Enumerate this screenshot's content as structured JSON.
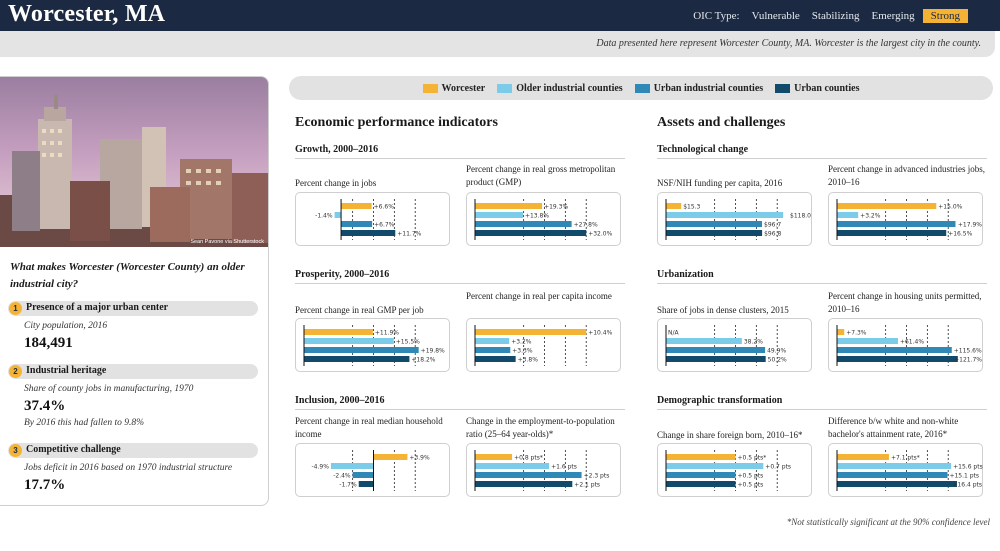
{
  "header": {
    "city": "Worcester, MA",
    "oic_label": "OIC Type:",
    "oic_types": [
      "Vulnerable",
      "Stabilizing",
      "Emerging",
      "Strong"
    ],
    "oic_selected": "Strong"
  },
  "subtitle": "Data presented here represent Worcester County, MA. Worcester is the largest city in the county.",
  "photo": {
    "credit": "Sean Pavone via Shutterstock"
  },
  "question": "What makes Worcester (Worcester County) an older industrial city?",
  "criteria": [
    {
      "number": "1",
      "title": "Presence of a major urban center",
      "label": "City population, 2016",
      "value": "184,491",
      "note": ""
    },
    {
      "number": "2",
      "title": "Industrial heritage",
      "label": "Share of county jobs in manufacturing, 1970",
      "value": "37.4%",
      "note": "By 2016 this had fallen to 9.8%"
    },
    {
      "number": "3",
      "title": "Competitive challenge",
      "label": "Jobs deficit in 2016 based on 1970 industrial structure",
      "value": "17.7%",
      "note": ""
    }
  ],
  "legend": [
    {
      "label": "Worcester",
      "color": "#f5b335"
    },
    {
      "label": "Older industrial counties",
      "color": "#7ccbe8"
    },
    {
      "label": "Urban industrial counties",
      "color": "#2f88b5"
    },
    {
      "label": "Urban counties",
      "color": "#124a6b"
    }
  ],
  "columns": {
    "left": "Economic performance indicators",
    "right": "Assets and challenges"
  },
  "sections": {
    "growth": "Growth, 2000–2016",
    "prosperity": "Prosperity, 2000–2016",
    "inclusion": "Inclusion, 2000–2016",
    "tech": "Technological change",
    "urban": "Urbanization",
    "demo": "Demographic transformation"
  },
  "footnote": "*Not statistically significant at the 90% confidence level",
  "chart_data": [
    {
      "id": "jobs",
      "type": "bar",
      "title": "Percent change in jobs",
      "series": [
        "Worcester",
        "Older industrial counties",
        "Urban industrial counties",
        "Urban counties"
      ],
      "values": [
        6.6,
        -1.4,
        6.7,
        11.7
      ],
      "labels": [
        "+6.6%",
        "-1.4%",
        "+6.7%",
        "+11.7%"
      ],
      "xlim": [
        -8,
        22
      ]
    },
    {
      "id": "gmp",
      "type": "bar",
      "title": "Percent change in real gross metropolitan product (GMP)",
      "series": [
        "Worcester",
        "Older industrial counties",
        "Urban industrial counties",
        "Urban counties"
      ],
      "values": [
        19.3,
        13.8,
        27.8,
        32.0
      ],
      "labels": [
        "+19.3%",
        "+13.8%",
        "+27.8%",
        "+32.0%"
      ],
      "xlim": [
        0,
        40
      ]
    },
    {
      "id": "gmpjob",
      "type": "bar",
      "title": "Percent change in real GMP per job",
      "series": [
        "Worcester",
        "Older industrial counties",
        "Urban industrial counties",
        "Urban counties"
      ],
      "values": [
        11.9,
        15.5,
        19.8,
        18.2
      ],
      "labels": [
        "+11.9%",
        "+15.5%",
        "+19.8%",
        "+18.2%"
      ],
      "xlim": [
        0,
        24
      ]
    },
    {
      "id": "percapita",
      "type": "bar",
      "title": "Percent change in real per capita income",
      "series": [
        "Worcester",
        "Older industrial counties",
        "Urban industrial counties",
        "Urban counties"
      ],
      "values": [
        10.4,
        3.2,
        3.3,
        3.8
      ],
      "labels": [
        "+10.4%",
        "+3.2%",
        "+3.3%",
        "+3.8%"
      ],
      "xlim": [
        0,
        13
      ]
    },
    {
      "id": "median",
      "type": "bar",
      "title": "Percent change in real median household income",
      "series": [
        "Worcester",
        "Older industrial counties",
        "Urban industrial counties",
        "Urban counties"
      ],
      "values": [
        3.9,
        -4.9,
        -2.4,
        -1.7
      ],
      "labels": [
        "+3.9%",
        "-4.9%",
        "-2.4%",
        "-1.7%"
      ],
      "xlim": [
        -8,
        8
      ]
    },
    {
      "id": "epop",
      "type": "bar",
      "title": "Change in the employment-to-population ratio (25–64 year-olds)*",
      "series": [
        "Worcester",
        "Older industrial counties",
        "Urban industrial counties",
        "Urban counties"
      ],
      "values": [
        0.8,
        1.6,
        2.3,
        2.1
      ],
      "labels": [
        "+0.8 pts*",
        "+1.6 pts",
        "+2.3 pts",
        "+2.1 pts"
      ],
      "xlim": [
        0,
        3
      ]
    },
    {
      "id": "nsf",
      "type": "bar",
      "title": "NSF/NIH funding per capita, 2016",
      "series": [
        "Worcester",
        "Older industrial counties",
        "Urban industrial counties",
        "Urban counties"
      ],
      "values": [
        15.3,
        118.0,
        96.7,
        96.8
      ],
      "labels": [
        "$15.3",
        "$118.0",
        "$96.7",
        "$96.8"
      ],
      "xlim": [
        0,
        140
      ]
    },
    {
      "id": "advind",
      "type": "bar",
      "title": "Percent change in advanced industries jobs, 2010–16",
      "series": [
        "Worcester",
        "Older industrial counties",
        "Urban industrial counties",
        "Urban counties"
      ],
      "values": [
        15.0,
        3.2,
        17.9,
        16.5
      ],
      "labels": [
        "+15.0%",
        "+3.2%",
        "+17.9%",
        "+16.5%"
      ],
      "xlim": [
        0,
        21
      ]
    },
    {
      "id": "dense",
      "type": "bar",
      "title": "Share of jobs in dense clusters, 2015",
      "series": [
        "Worcester",
        "Older industrial counties",
        "Urban industrial counties",
        "Urban counties"
      ],
      "values": [
        null,
        38.2,
        49.9,
        50.2
      ],
      "labels": [
        "N/A",
        "38.2%",
        "49.9%",
        "50.2%"
      ],
      "xlim": [
        0,
        70
      ]
    },
    {
      "id": "housing",
      "type": "bar",
      "title": "Percent change in housing units permitted, 2010–16",
      "series": [
        "Worcester",
        "Older industrial counties",
        "Urban industrial counties",
        "Urban counties"
      ],
      "values": [
        7.3,
        61.4,
        115.6,
        121.7
      ],
      "labels": [
        "+7.3%",
        "+61.4%",
        "+115.6%",
        "+121.7%"
      ],
      "xlim": [
        0,
        140
      ]
    },
    {
      "id": "foreign",
      "type": "bar",
      "title": "Change in share foreign born, 2010–16*",
      "series": [
        "Worcester",
        "Older industrial counties",
        "Urban industrial counties",
        "Urban counties"
      ],
      "values": [
        0.5,
        0.7,
        0.5,
        0.5
      ],
      "labels": [
        "+0.5 pts*",
        "+0.7 pts",
        "+0.5 pts",
        "+0.5 pts"
      ],
      "xlim": [
        0,
        1
      ]
    },
    {
      "id": "bachelor",
      "type": "bar",
      "title": "Difference b/w white and non-white bachelor's attainment rate, 2016*",
      "series": [
        "Worcester",
        "Older industrial counties",
        "Urban industrial counties",
        "Urban counties"
      ],
      "values": [
        7.1,
        15.6,
        15.1,
        16.4
      ],
      "labels": [
        "+7.1 pts*",
        "+15.6 pts",
        "+15.1 pts",
        "+16.4 pts"
      ],
      "xlim": [
        0,
        19
      ]
    }
  ]
}
